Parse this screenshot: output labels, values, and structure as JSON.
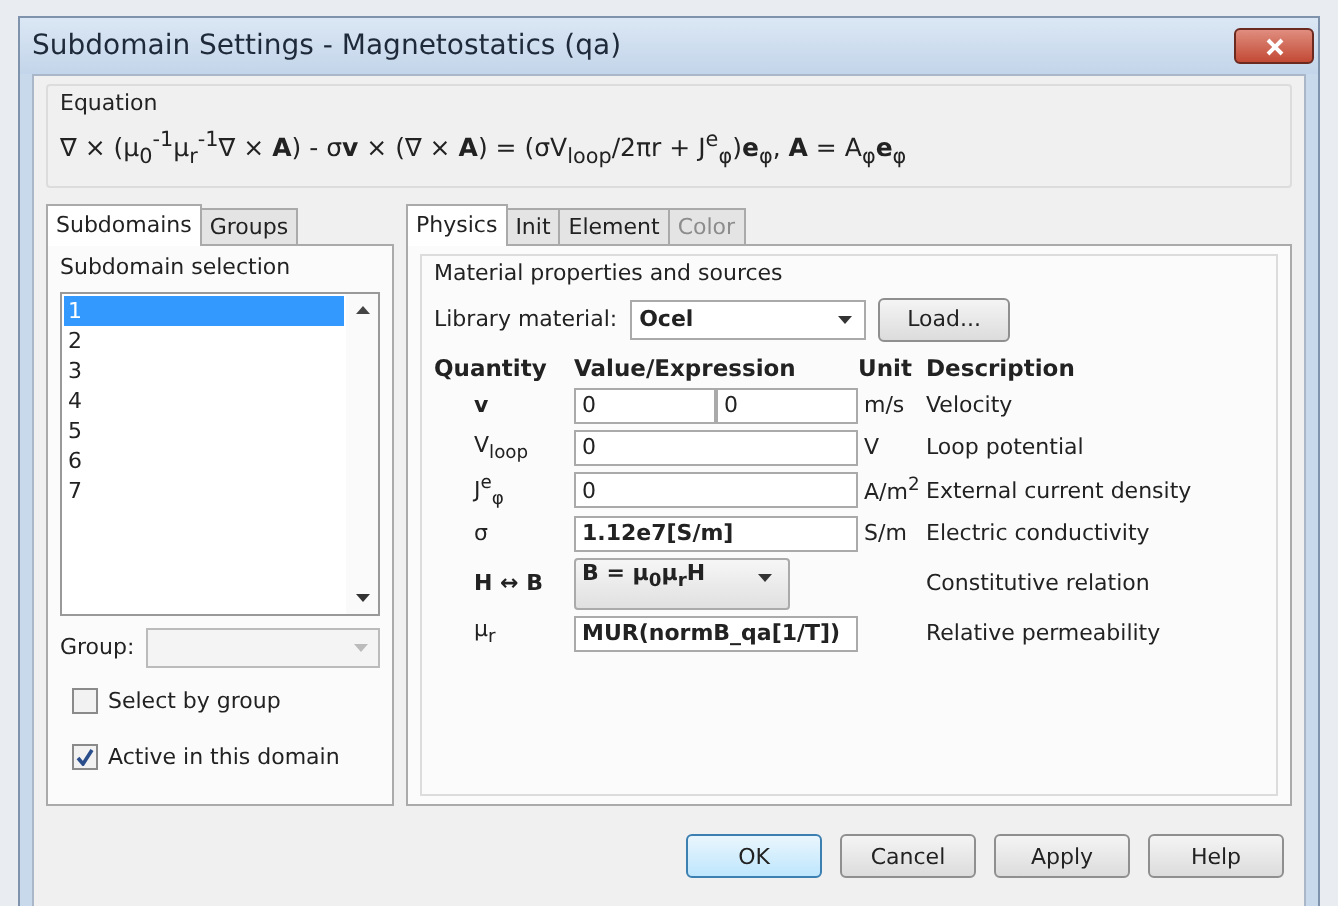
{
  "window": {
    "title": "Subdomain Settings - Magnetostatics (qa)"
  },
  "equation": {
    "label": "Equation",
    "formula": "∇ × (μ$_{0}$$^{-1}$μ$_{r}$$^{-1}$∇ × **A**) - σ**v** × (∇ × **A**) = (σV$_{loop}$/2πr + J$^{e}$$_{φ}$)**e**$_{φ}$, **A** = A$_{φ}$**e**$_{φ}$"
  },
  "left_tabs": [
    {
      "label": "Subdomains",
      "selected": true
    },
    {
      "label": "Groups",
      "selected": false
    }
  ],
  "subdomain_selection": {
    "label": "Subdomain selection",
    "items": [
      {
        "label": "1",
        "selected": true
      },
      {
        "label": "2",
        "selected": false
      },
      {
        "label": "3",
        "selected": false
      },
      {
        "label": "4",
        "selected": false
      },
      {
        "label": "5",
        "selected": false
      },
      {
        "label": "6",
        "selected": false
      },
      {
        "label": "7",
        "selected": false
      }
    ],
    "group_label": "Group:",
    "group_disabled": true,
    "checkboxes": [
      {
        "label": "Select by group",
        "checked": false
      },
      {
        "label": "Active in this domain",
        "checked": true
      }
    ]
  },
  "right_tabs": [
    {
      "label": "Physics",
      "selected": true,
      "disabled": false
    },
    {
      "label": "Init",
      "selected": false,
      "disabled": false
    },
    {
      "label": "Element",
      "selected": false,
      "disabled": false
    },
    {
      "label": "Color",
      "selected": false,
      "disabled": true
    }
  ],
  "material": {
    "title": "Material properties and sources",
    "library_label": "Library material:",
    "library_value": "Ocel",
    "load_button": "Load..."
  },
  "table": {
    "columns": [
      "Quantity",
      "Value/Expression",
      "Unit",
      "Description"
    ],
    "rows": [
      {
        "kind": "pair",
        "quantity": "v",
        "quantity_bold": true,
        "values": [
          "0",
          "0"
        ],
        "value_bold": false,
        "unit": "m/s",
        "description": "Velocity"
      },
      {
        "kind": "field",
        "quantity": "V$_{loop}$",
        "quantity_bold": false,
        "values": [
          "0"
        ],
        "value_bold": false,
        "unit": "V",
        "description": "Loop potential"
      },
      {
        "kind": "field",
        "quantity": "J$^{e}$$_{φ}$",
        "quantity_bold": false,
        "values": [
          "0"
        ],
        "value_bold": false,
        "unit": "A/m$^{2}$",
        "description": "External current density"
      },
      {
        "kind": "field",
        "quantity": "σ",
        "quantity_bold": false,
        "values": [
          "1.12e7[S/m]"
        ],
        "value_bold": true,
        "unit": "S/m",
        "description": "Electric conductivity"
      },
      {
        "kind": "select",
        "quantity": "H ↔ B",
        "quantity_bold": true,
        "values": [
          "B = μ$_{0}$μ$_{r}$H"
        ],
        "value_bold": true,
        "description": "Constitutive relation"
      },
      {
        "kind": "field",
        "quantity": "μ$_{r}$",
        "quantity_bold": false,
        "values": [
          "MUR(normB_qa[1/T])"
        ],
        "value_bold": true,
        "description": "Relative permeability"
      }
    ]
  },
  "buttons": [
    {
      "label": "OK",
      "default": true
    },
    {
      "label": "Cancel",
      "default": false
    },
    {
      "label": "Apply",
      "default": false
    },
    {
      "label": "Help",
      "default": false
    }
  ]
}
